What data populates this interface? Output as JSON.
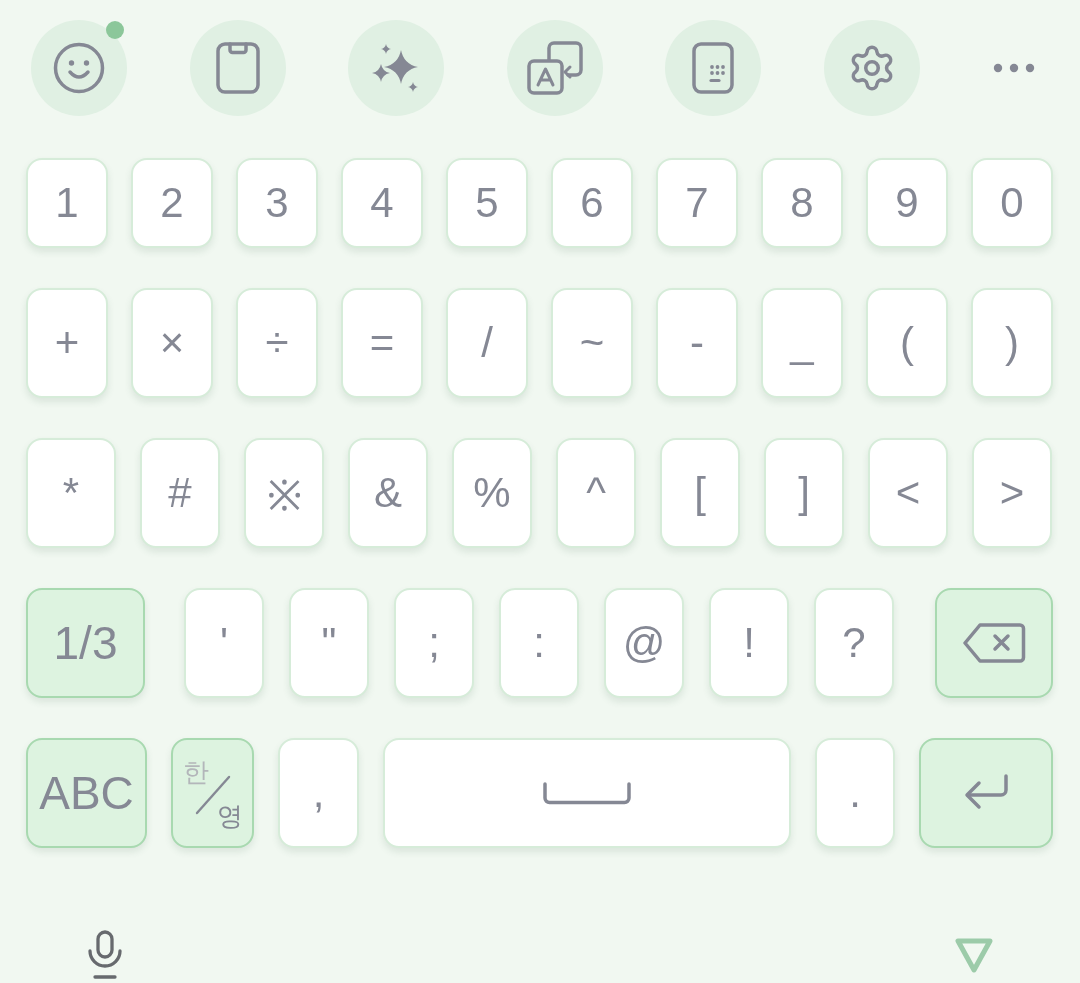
{
  "toolbar": {
    "buttons": [
      {
        "kind": "emoji",
        "badge": true
      },
      {
        "kind": "clipboard",
        "badge": false
      },
      {
        "kind": "sparkle",
        "badge": false
      },
      {
        "kind": "translate",
        "badge": false
      },
      {
        "kind": "keypad",
        "badge": false
      },
      {
        "kind": "settings",
        "badge": false
      },
      {
        "kind": "more",
        "badge": false
      }
    ]
  },
  "keyboard": {
    "rows": [
      {
        "keys": [
          {
            "kind": "char",
            "label": "1"
          },
          {
            "kind": "char",
            "label": "2"
          },
          {
            "kind": "char",
            "label": "3"
          },
          {
            "kind": "char",
            "label": "4"
          },
          {
            "kind": "char",
            "label": "5"
          },
          {
            "kind": "char",
            "label": "6"
          },
          {
            "kind": "char",
            "label": "7"
          },
          {
            "kind": "char",
            "label": "8"
          },
          {
            "kind": "char",
            "label": "9"
          },
          {
            "kind": "char",
            "label": "0"
          }
        ]
      },
      {
        "keys": [
          {
            "kind": "char",
            "label": "+"
          },
          {
            "kind": "char",
            "label": "×"
          },
          {
            "kind": "char",
            "label": "÷"
          },
          {
            "kind": "char",
            "label": "="
          },
          {
            "kind": "char",
            "label": "/"
          },
          {
            "kind": "char",
            "label": "~"
          },
          {
            "kind": "char",
            "label": "-"
          },
          {
            "kind": "char",
            "label": "_"
          },
          {
            "kind": "char",
            "label": "("
          },
          {
            "kind": "char",
            "label": ")"
          }
        ]
      },
      {
        "keys": [
          {
            "kind": "char",
            "label": "*"
          },
          {
            "kind": "char",
            "label": "#"
          },
          {
            "kind": "char",
            "label": "※"
          },
          {
            "kind": "char",
            "label": "&"
          },
          {
            "kind": "char",
            "label": "%"
          },
          {
            "kind": "char",
            "label": "^"
          },
          {
            "kind": "char",
            "label": "["
          },
          {
            "kind": "char",
            "label": "]"
          },
          {
            "kind": "char",
            "label": "<"
          },
          {
            "kind": "char",
            "label": ">"
          }
        ]
      },
      {
        "keys": [
          {
            "kind": "mode",
            "label": "1/3"
          },
          {
            "kind": "char",
            "label": "'"
          },
          {
            "kind": "char",
            "label": "\""
          },
          {
            "kind": "char",
            "label": ";"
          },
          {
            "kind": "char",
            "label": ":"
          },
          {
            "kind": "char",
            "label": "@"
          },
          {
            "kind": "char",
            "label": "!"
          },
          {
            "kind": "char",
            "label": "?"
          },
          {
            "kind": "backspace"
          }
        ]
      },
      {
        "keys": [
          {
            "kind": "mode",
            "label": "ABC"
          },
          {
            "kind": "lang",
            "top": "한",
            "bottom": "영"
          },
          {
            "kind": "char",
            "label": ","
          },
          {
            "kind": "space"
          },
          {
            "kind": "char",
            "label": "."
          },
          {
            "kind": "enter"
          }
        ]
      }
    ]
  },
  "bottom_bar": {
    "buttons": [
      {
        "kind": "mic"
      },
      {
        "kind": "hide"
      }
    ]
  }
}
